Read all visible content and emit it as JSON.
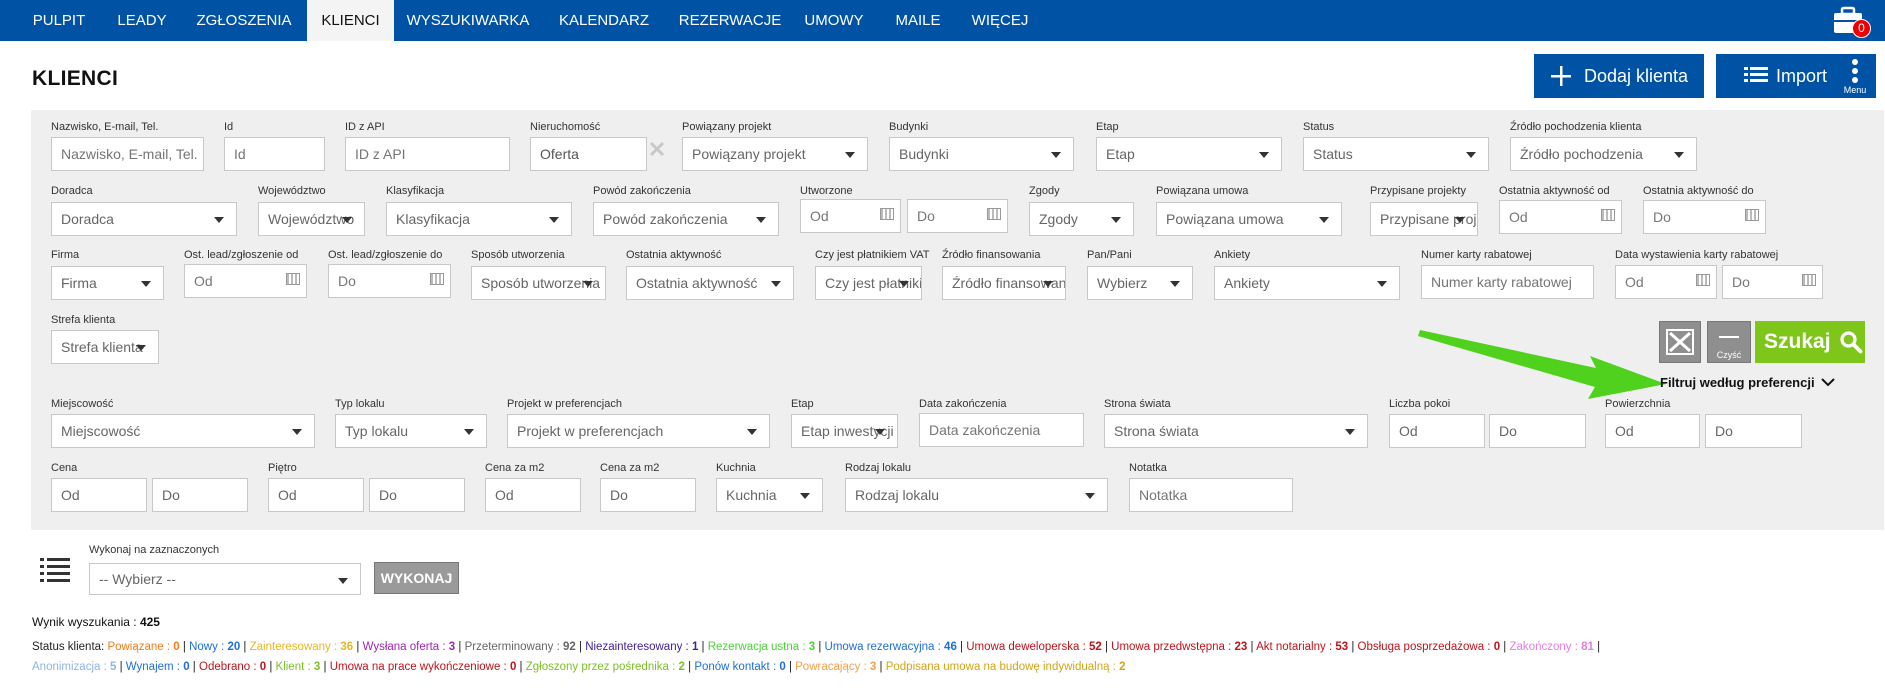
{
  "nav": {
    "items": [
      "PULPIT",
      "LEADY",
      "ZGŁOSZENIA",
      "KLIENCI",
      "WYSZUKIWARKA",
      "KALENDARZ",
      "REZERWACJE",
      "UMOWY",
      "MAILE",
      "WIĘCEJ"
    ],
    "active": "KLIENCI",
    "notification_count": "0"
  },
  "header": {
    "title": "KLIENCI",
    "add_client_label": "Dodaj klienta",
    "import_label": "Import",
    "menu_label": "Menu"
  },
  "filters": {
    "name": {
      "label": "Nazwisko, E-mail, Tel.",
      "placeholder": "Nazwisko, E-mail, Tel."
    },
    "id": {
      "label": "Id",
      "placeholder": "Id"
    },
    "api_id": {
      "label": "ID z API",
      "placeholder": "ID z API"
    },
    "property": {
      "label": "Nieruchomość",
      "value": "Oferta"
    },
    "project": {
      "label": "Powiązany projekt",
      "value": "Powiązany projekt"
    },
    "buildings": {
      "label": "Budynki",
      "value": "Budynki"
    },
    "stage": {
      "label": "Etap",
      "value": "Etap"
    },
    "status": {
      "label": "Status",
      "value": "Status"
    },
    "source": {
      "label": "Źródło pochodzenia klienta",
      "value": "Źródło pochodzenia"
    },
    "advisor": {
      "label": "Doradca",
      "value": "Doradca"
    },
    "voivodeship": {
      "label": "Województwo",
      "value": "Województwo"
    },
    "classification": {
      "label": "Klasyfikacja",
      "value": "Klasyfikacja"
    },
    "end_reason": {
      "label": "Powód zakończenia",
      "value": "Powód zakończenia"
    },
    "created": {
      "label": "Utworzone",
      "from": "Od",
      "to": "Do"
    },
    "consents": {
      "label": "Zgody",
      "value": "Zgody"
    },
    "linked_contract": {
      "label": "Powiązana umowa",
      "value": "Powiązana umowa"
    },
    "assigned_projects": {
      "label": "Przypisane projekty",
      "value": "Przypisane projekty"
    },
    "last_activity_from": {
      "label": "Ostatnia aktywność od",
      "value": "Od"
    },
    "last_activity_to": {
      "label": "Ostatnia aktywność do",
      "value": "Do"
    },
    "company": {
      "label": "Firma",
      "value": "Firma"
    },
    "lead_from": {
      "label": "Ost. lead/zgłoszenie od",
      "value": "Od"
    },
    "lead_to": {
      "label": "Ost. lead/zgłoszenie do",
      "value": "Do"
    },
    "creation_method": {
      "label": "Sposób utworzenia",
      "value": "Sposób utworzenia"
    },
    "last_activity": {
      "label": "Ostatnia aktywność",
      "value": "Ostatnia aktywność"
    },
    "vat_payer": {
      "label": "Czy jest płatnikiem VAT",
      "value": "Czy jest płatnikiem VAT"
    },
    "financing": {
      "label": "Źródło finansowania",
      "value": "Źródło finansowania"
    },
    "salutation": {
      "label": "Pan/Pani",
      "value": "Wybierz"
    },
    "surveys": {
      "label": "Ankiety",
      "value": "Ankiety"
    },
    "card_number": {
      "label": "Numer karty rabatowej",
      "placeholder": "Numer karty rabatowej"
    },
    "card_date": {
      "label": "Data wystawienia karty rabatowej",
      "from": "Od",
      "to": "Do"
    },
    "zone": {
      "label": "Strefa klienta",
      "value": "Strefa klienta"
    }
  },
  "actions": {
    "clear_label": "Czyść",
    "search_label": "Szukaj",
    "pref_filter_label": "Filtruj według preferencji"
  },
  "pref_filters": {
    "city": {
      "label": "Miejscowość",
      "value": "Miejscowość"
    },
    "unit_type": {
      "label": "Typ lokalu",
      "value": "Typ lokalu"
    },
    "pref_project": {
      "label": "Projekt w preferencjach",
      "value": "Projekt w preferencjach"
    },
    "stage": {
      "label": "Etap",
      "value": "Etap inwestycji"
    },
    "end_date": {
      "label": "Data zakończenia",
      "placeholder": "Data zakończenia"
    },
    "orientation": {
      "label": "Strona świata",
      "value": "Strona świata"
    },
    "rooms": {
      "label": "Liczba pokoi",
      "from": "Od",
      "to": "Do"
    },
    "area": {
      "label": "Powierzchnia",
      "from": "Od",
      "to": "Do"
    },
    "price": {
      "label": "Cena",
      "from": "Od",
      "to": "Do"
    },
    "floor": {
      "label": "Piętro",
      "from": "Od",
      "to": "Do"
    },
    "price_m2": {
      "label": "Cena za m2",
      "value": "Od"
    },
    "price_m2_to": {
      "label": "Cena za m2",
      "value": "Do"
    },
    "kitchen": {
      "label": "Kuchnia",
      "value": "Kuchnia"
    },
    "unit_kind": {
      "label": "Rodzaj lokalu",
      "value": "Rodzaj lokalu"
    },
    "note": {
      "label": "Notatka",
      "placeholder": "Notatka"
    }
  },
  "bulk": {
    "label": "Wykonaj na zaznaczonych",
    "value": "-- Wybierz --",
    "run_label": "WYKONAJ"
  },
  "results": {
    "label": "Wynik wyszukania :",
    "count": "425"
  },
  "status": {
    "label": "Status klienta:",
    "line1": [
      {
        "name": "Powiązane",
        "count": "0",
        "color": "#f07d1a"
      },
      {
        "name": "Nowy",
        "count": "20",
        "color": "#1e6fd9"
      },
      {
        "name": "Zainteresowany",
        "count": "36",
        "color": "#e5b822"
      },
      {
        "name": "Wysłana oferta",
        "count": "3",
        "color": "#9c27b0"
      },
      {
        "name": "Przeterminowany",
        "count": "92",
        "color": "#666666"
      },
      {
        "name": "Niezainteresowany",
        "count": "1",
        "color": "#3f1d9e"
      },
      {
        "name": "Rezerwacja ustna",
        "count": "3",
        "color": "#4cd137"
      },
      {
        "name": "Umowa rezerwacyjna",
        "count": "46",
        "color": "#1e6fd9"
      },
      {
        "name": "Umowa deweloperska",
        "count": "52",
        "color": "#c0131b"
      },
      {
        "name": "Umowa przedwstępna",
        "count": "23",
        "color": "#c0131b"
      },
      {
        "name": "Akt notarialny",
        "count": "53",
        "color": "#c0131b"
      },
      {
        "name": "Obsługa posprzedażowa",
        "count": "0",
        "color": "#c0131b"
      },
      {
        "name": "Zakończony",
        "count": "81",
        "color": "#e07ee0"
      }
    ],
    "line2": [
      {
        "name": "Anonimizacja",
        "count": "5",
        "color": "#8fb4e8"
      },
      {
        "name": "Wynajem",
        "count": "0",
        "color": "#1e6fd9"
      },
      {
        "name": "Odebrano",
        "count": "0",
        "color": "#c0131b"
      },
      {
        "name": "Klient",
        "count": "3",
        "color": "#7cbf26"
      },
      {
        "name": "Umowa na prace wykończeniowe",
        "count": "0",
        "color": "#c0131b"
      },
      {
        "name": "Zgłoszony przez pośrednika",
        "count": "2",
        "color": "#7cbf26"
      },
      {
        "name": "Ponów kontakt",
        "count": "0",
        "color": "#1e6fd9"
      },
      {
        "name": "Powracający",
        "count": "3",
        "color": "#f3a14a"
      },
      {
        "name": "Podpisana umowa na budowę indywidualną",
        "count": "2",
        "color": "#d4a516"
      }
    ]
  },
  "colors": {
    "brand": "#0052a5",
    "search": "#7ec61a",
    "arrow": "#4fd11e"
  }
}
